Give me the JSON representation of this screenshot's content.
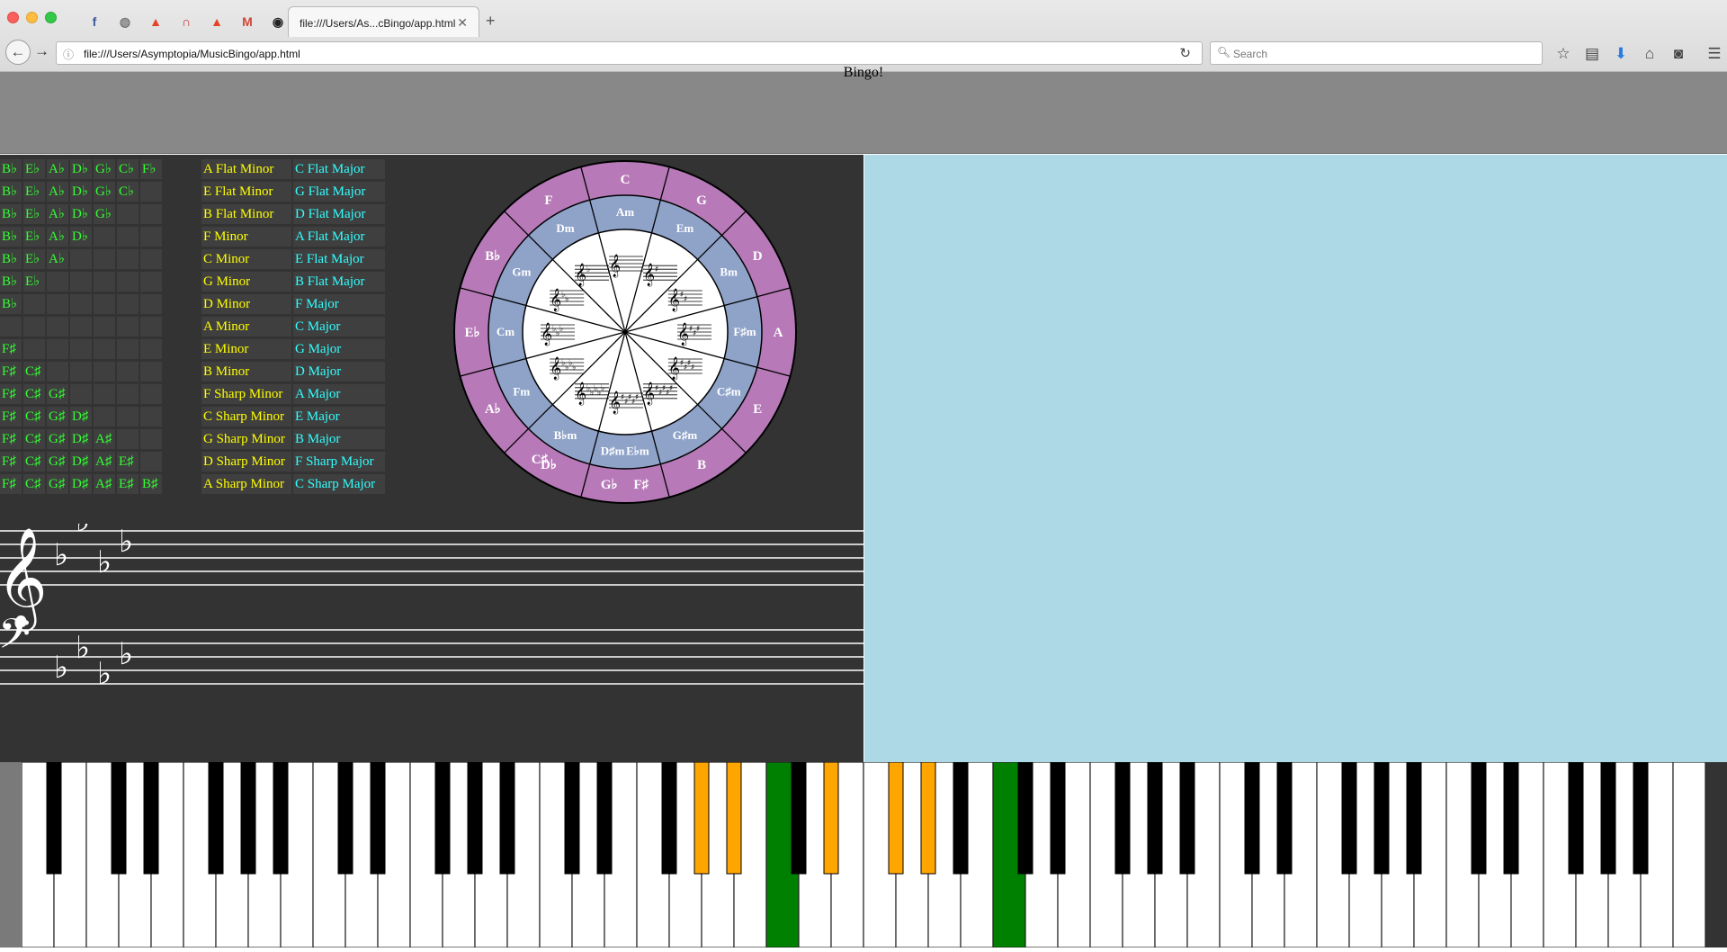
{
  "browser": {
    "tab_title": "file:///Users/As...cBingo/app.html",
    "url": "file:///Users/Asymptopia/MusicBingo/app.html",
    "search_placeholder": "Search",
    "pinned_tabs": [
      {
        "icon": "facebook-icon",
        "glyph": "f",
        "color": "#3b5998"
      },
      {
        "icon": "globe-icon",
        "glyph": "◍",
        "color": "#777777"
      },
      {
        "icon": "gitlab-icon",
        "glyph": "▲",
        "color": "#e24329"
      },
      {
        "icon": "arc-icon",
        "glyph": "∩",
        "color": "#cc3333"
      },
      {
        "icon": "gitlab-icon",
        "glyph": "▲",
        "color": "#e24329"
      },
      {
        "icon": "gmail-icon",
        "glyph": "M",
        "color": "#d14836"
      },
      {
        "icon": "github-icon",
        "glyph": "◉",
        "color": "#222222"
      }
    ]
  },
  "app": {
    "title": "Bingo!",
    "colors": {
      "accidental_text": "#33ff33",
      "minor_text": "#ffff00",
      "major_text": "#33ffff",
      "outer_ring": "#b779b8",
      "middle_ring": "#8fa3c9",
      "right_panel": "#add8e6",
      "key_highlight_orange": "#ffa500",
      "key_highlight_green": "#008000"
    },
    "key_table": [
      {
        "acc": [
          "B♭",
          "E♭",
          "A♭",
          "D♭",
          "G♭",
          "C♭",
          "F♭"
        ],
        "minor": "A Flat Minor",
        "major": "C Flat Major"
      },
      {
        "acc": [
          "B♭",
          "E♭",
          "A♭",
          "D♭",
          "G♭",
          "C♭",
          ""
        ],
        "minor": "E Flat Minor",
        "major": "G Flat Major"
      },
      {
        "acc": [
          "B♭",
          "E♭",
          "A♭",
          "D♭",
          "G♭",
          "",
          ""
        ],
        "minor": "B Flat Minor",
        "major": "D Flat Major"
      },
      {
        "acc": [
          "B♭",
          "E♭",
          "A♭",
          "D♭",
          "",
          "",
          ""
        ],
        "minor": "F Minor",
        "major": "A Flat Major"
      },
      {
        "acc": [
          "B♭",
          "E♭",
          "A♭",
          "",
          "",
          "",
          ""
        ],
        "minor": "C Minor",
        "major": "E Flat Major"
      },
      {
        "acc": [
          "B♭",
          "E♭",
          "",
          "",
          "",
          "",
          ""
        ],
        "minor": "G Minor",
        "major": "B Flat Major"
      },
      {
        "acc": [
          "B♭",
          "",
          "",
          "",
          "",
          "",
          ""
        ],
        "minor": "D Minor",
        "major": "F Major"
      },
      {
        "acc": [
          "",
          "",
          "",
          "",
          "",
          "",
          ""
        ],
        "minor": "A Minor",
        "major": "C Major"
      },
      {
        "acc": [
          "F♯",
          "",
          "",
          "",
          "",
          "",
          ""
        ],
        "minor": "E Minor",
        "major": "G Major"
      },
      {
        "acc": [
          "F♯",
          "C♯",
          "",
          "",
          "",
          "",
          ""
        ],
        "minor": "B Minor",
        "major": "D Major"
      },
      {
        "acc": [
          "F♯",
          "C♯",
          "G♯",
          "",
          "",
          "",
          ""
        ],
        "minor": "F Sharp Minor",
        "major": "A Major"
      },
      {
        "acc": [
          "F♯",
          "C♯",
          "G♯",
          "D♯",
          "",
          "",
          ""
        ],
        "minor": "C Sharp Minor",
        "major": "E Major"
      },
      {
        "acc": [
          "F♯",
          "C♯",
          "G♯",
          "D♯",
          "A♯",
          "",
          ""
        ],
        "minor": "G Sharp Minor",
        "major": "B Major"
      },
      {
        "acc": [
          "F♯",
          "C♯",
          "G♯",
          "D♯",
          "A♯",
          "E♯",
          ""
        ],
        "minor": "D Sharp Minor",
        "major": "F Sharp Major"
      },
      {
        "acc": [
          "F♯",
          "C♯",
          "G♯",
          "D♯",
          "A♯",
          "E♯",
          "B♯"
        ],
        "minor": "A Sharp Minor",
        "major": "C Sharp Major"
      }
    ],
    "circle_of_fifths": {
      "major_keys": [
        "C",
        "G",
        "D",
        "A",
        "E",
        "B",
        "G♭",
        "D♭",
        "A♭",
        "E♭",
        "B♭",
        "F"
      ],
      "extra_major_labels": [
        "F♯",
        "C♯"
      ],
      "minor_keys": [
        "Am",
        "Em",
        "Bm",
        "F♯m",
        "C♯m",
        "G♯m",
        "D♯m",
        "B♭m",
        "Fm",
        "Cm",
        "Gm",
        "Dm"
      ],
      "extra_minor_label": "E♭m",
      "signatures": [
        {
          "type": "none",
          "count": 0
        },
        {
          "type": "sharp",
          "count": 1
        },
        {
          "type": "sharp",
          "count": 2
        },
        {
          "type": "sharp",
          "count": 3
        },
        {
          "type": "sharp",
          "count": 4
        },
        {
          "type": "sharp",
          "count": 5
        },
        {
          "type": "both",
          "count": 6
        },
        {
          "type": "flat",
          "count": 5
        },
        {
          "type": "flat",
          "count": 4
        },
        {
          "type": "flat",
          "count": 3
        },
        {
          "type": "flat",
          "count": 2
        },
        {
          "type": "flat",
          "count": 1
        }
      ]
    },
    "staff": {
      "treble_clef": "𝄞",
      "bass_clef": "𝄢",
      "key_flats": 4
    },
    "piano": {
      "white_key_count": 52,
      "first_note": "A0",
      "highlight_orange": [
        "G♯3",
        "A♯3",
        "D♯4",
        "F♯4",
        "G♯4"
      ],
      "highlight_green": [
        "C4",
        "C5"
      ]
    }
  }
}
